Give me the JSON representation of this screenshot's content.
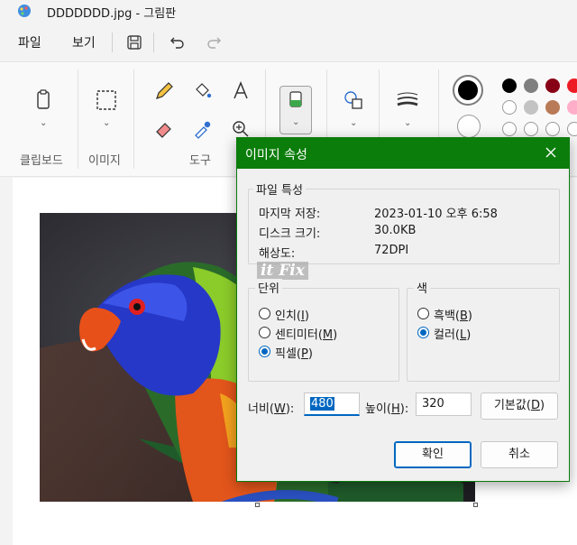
{
  "window": {
    "title": "DDDDDDD.jpg - 그림판"
  },
  "menu": {
    "file": "파일",
    "view": "보기"
  },
  "ribbon": {
    "groups": {
      "clipboard": "클립보드",
      "image": "이미지",
      "tools": "도구"
    }
  },
  "palette": {
    "primary": "#000000",
    "secondary": "#ffffff",
    "row1": [
      "#000000",
      "#7f7f7f",
      "#880015",
      "#ed1c24"
    ],
    "row2": [
      "#ffffff",
      "#c3c3c3",
      "#b97a57",
      "#ffaec9"
    ],
    "row3": [
      "#ffffff",
      "#ffffff",
      "#ffffff",
      "#ffffff"
    ]
  },
  "dialog": {
    "title": "이미지 속성",
    "file_props": {
      "group_label": "파일 특성",
      "last_saved_label": "마지막 저장:",
      "last_saved_value": "2023-01-10 오후 6:58",
      "disk_size_label": "디스크 크기:",
      "disk_size_value": "30.0KB",
      "resolution_label": "해상도:",
      "resolution_value": "72DPI"
    },
    "units": {
      "group_label": "단위",
      "inch": "인치",
      "inch_key": "I",
      "cm": "센티미터",
      "cm_key": "M",
      "pixel": "픽셀",
      "pixel_key": "P",
      "selected": "pixel"
    },
    "colors": {
      "group_label": "색",
      "bw": "흑백",
      "bw_key": "B",
      "color": "컬러",
      "color_key": "L",
      "selected": "color"
    },
    "width_label": "너비",
    "width_key": "W",
    "width_value": "480",
    "height_label": "높이",
    "height_key": "H",
    "height_value": "320",
    "default_button": "기본값",
    "default_key": "D",
    "ok_button": "확인",
    "cancel_button": "취소"
  },
  "watermark": "it Fix"
}
